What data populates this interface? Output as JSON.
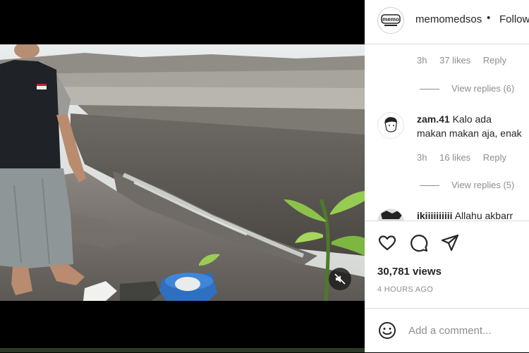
{
  "post": {
    "username": "memomedsos",
    "separator": "•",
    "follow_label": "Follow",
    "avatar_text": "memo"
  },
  "comments": [
    {
      "meta": {
        "time": "3h",
        "likes": "37 likes",
        "reply": "Reply"
      },
      "view_replies": "View replies (6)"
    },
    {
      "user": "zam.41",
      "text": "Kalo ada makan makan aja, enak",
      "meta": {
        "time": "3h",
        "likes": "16 likes",
        "reply": "Reply"
      },
      "view_replies": "View replies (5)"
    },
    {
      "user": "ikiiiiiiiiii",
      "text": "Allahu akbarr"
    }
  ],
  "stats": {
    "views": "30,781 views",
    "time_ago": "4 HOURS AGO"
  },
  "add_comment": {
    "placeholder": "Add a comment..."
  },
  "icons": {
    "like": "heart-icon",
    "comment": "comment-icon",
    "share": "share-icon",
    "emoji": "emoji-icon",
    "mute": "muted-speaker-icon"
  }
}
